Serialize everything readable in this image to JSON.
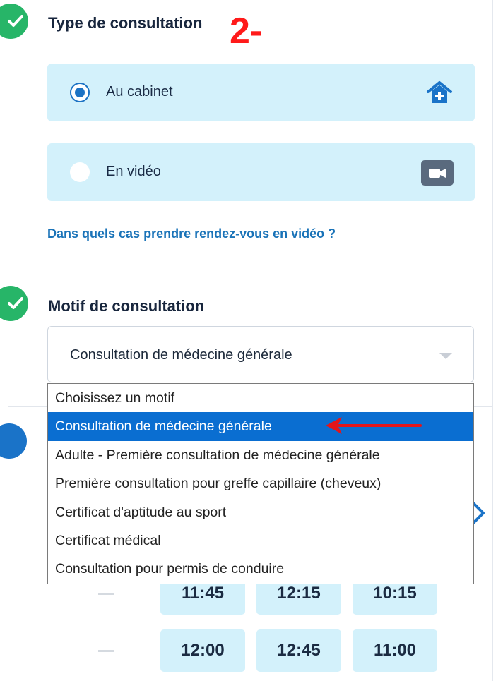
{
  "annotation": {
    "text": "2-"
  },
  "consultation_type": {
    "title": "Type de consultation",
    "options": [
      {
        "label": "Au cabinet",
        "selected": true,
        "icon": "house-plus-icon"
      },
      {
        "label": "En vidéo",
        "selected": false,
        "icon": "video-camera-icon"
      }
    ],
    "video_link": "Dans quels cas prendre rendez-vous en vidéo ?"
  },
  "motif": {
    "title": "Motif de consultation",
    "selected_value": "Consultation de médecine générale",
    "options": [
      "Choisissez un motif",
      "Consultation de médecine générale",
      "Adulte - Première consultation de médecine générale",
      "Première consultation pour greffe capillaire (cheveux)",
      "Certificat d'aptitude au sport",
      "Certificat médical",
      "Consultation pour permis de conduire"
    ],
    "highlighted_index": 1
  },
  "availability": {
    "rows": [
      {
        "slots": [
          "11:45",
          "12:15",
          "10:15"
        ]
      },
      {
        "slots": [
          "12:00",
          "12:45",
          "11:00"
        ]
      }
    ]
  },
  "colors": {
    "step_done": "#27b568",
    "step_current": "#1a73c8",
    "card_bg": "#d3f1fb",
    "link": "#1a73b8",
    "annotation": "#ff1a1a",
    "dropdown_highlight": "#0a6ed1"
  }
}
